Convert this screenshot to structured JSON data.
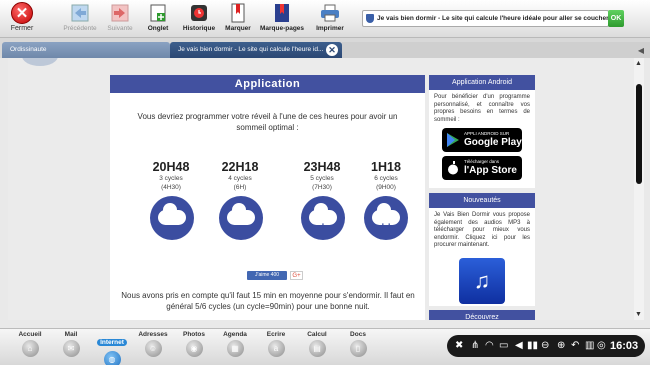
{
  "toolbar": {
    "close_label": "Fermer",
    "buttons": [
      {
        "label": "Précédente",
        "enabled": false,
        "icon": "back-arrow-icon"
      },
      {
        "label": "Suivante",
        "enabled": false,
        "icon": "forward-arrow-icon"
      },
      {
        "label": "Onglet",
        "enabled": true,
        "icon": "tab-icon"
      },
      {
        "label": "Historique",
        "enabled": true,
        "icon": "history-icon"
      },
      {
        "label": "Marquer",
        "enabled": true,
        "icon": "bookmark-icon"
      },
      {
        "label": "Marque-pages",
        "enabled": true,
        "icon": "bookmarks-icon"
      },
      {
        "label": "Imprimer",
        "enabled": true,
        "icon": "printer-icon"
      }
    ],
    "url": "Je vais bien dormir - Le site qui calcule l'heure idéale pour aller se coucher",
    "go_label": "OK"
  },
  "tabs": [
    {
      "label": "Ordissinaute",
      "active": false
    },
    {
      "label": "Je vais bien dormir - Le site qui calcule l'heure id...",
      "active": true
    }
  ],
  "main": {
    "header": "Application",
    "intro": "Vous devriez programmer votre réveil à l'une de ces heures pour avoir un sommeil optimal :",
    "options": [
      {
        "time": "20H48",
        "cycles": "3 cycles",
        "duration": "(4H30)",
        "symbol": "- -"
      },
      {
        "time": "22H18",
        "cycles": "4 cycles",
        "duration": "(6H)",
        "symbol": "-"
      },
      {
        "time": "23H48",
        "cycles": "5 cycles",
        "duration": "(7H30)",
        "symbol": "+"
      },
      {
        "time": "1H18",
        "cycles": "6 cycles",
        "duration": "(9H00)",
        "symbol": "++"
      }
    ],
    "like_label": "J'aime 400",
    "gplus_label": "G+",
    "footer_text": "Nous avons pris en compte qu'il faut 15 min en moyenne pour s'endormir. Il faut en général 5/6 cycles (un cycle=90min) pour une bonne nuit."
  },
  "sidebar": {
    "android": {
      "header": "Application Android",
      "text": "Pour bénéficier d'un programme personnalisé, et connaître vos propres besoins en termes de sommeil :",
      "gplay_small": "APPLI ANDROID SUR",
      "gplay_large": "Google Play",
      "appstore_small": "Télécharger dans",
      "appstore_large": "l'App Store"
    },
    "news": {
      "header": "Nouveautés",
      "text": "Je Vais Bien Dormir vous propose également des audios MP3 à télécharger pour mieux vous endormir. Cliquez ici pour les procurer maintenant."
    },
    "third_header": "Découvrez"
  },
  "dock": {
    "items": [
      {
        "label": "Accueil",
        "active": false
      },
      {
        "label": "Mail",
        "active": false
      },
      {
        "label": "Internet",
        "active": true
      },
      {
        "label": "Adresses",
        "active": false
      },
      {
        "label": "Photos",
        "active": false
      },
      {
        "label": "Agenda",
        "active": false
      },
      {
        "label": "Ecrire",
        "active": false
      },
      {
        "label": "Calcul",
        "active": false
      },
      {
        "label": "Docs",
        "active": false
      }
    ],
    "time": "16:03"
  },
  "colors": {
    "accent": "#4251a0",
    "tab_active": "#2b4773",
    "ok_green": "#2e9a2e",
    "close_red": "#c30000"
  }
}
